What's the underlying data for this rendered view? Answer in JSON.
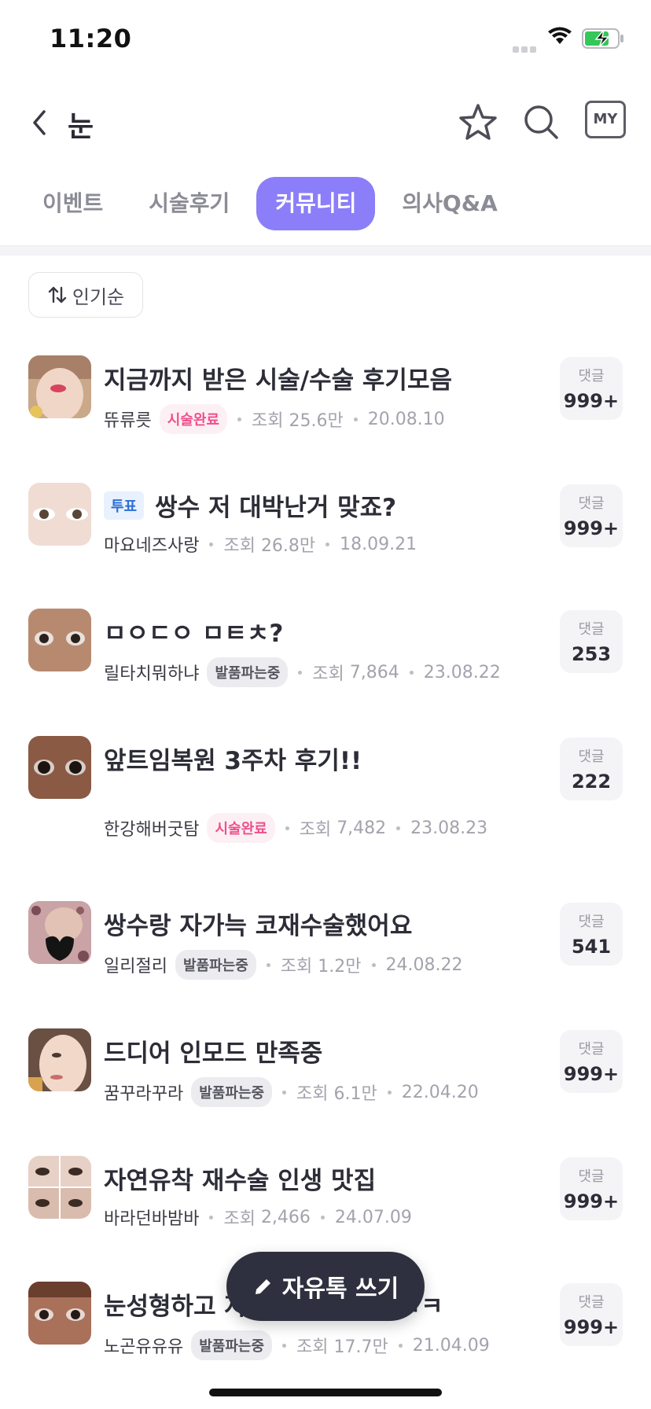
{
  "status_bar": {
    "time": "11:20"
  },
  "header": {
    "back_label": "<",
    "title": "눈",
    "my_label": "MY"
  },
  "tabs": [
    {
      "label": "이벤트",
      "active": false
    },
    {
      "label": "시술후기",
      "active": false
    },
    {
      "label": "커뮤니티",
      "active": true
    },
    {
      "label": "의사Q&A",
      "active": false
    }
  ],
  "sort": {
    "label": "인기순"
  },
  "comment_label": "댓글",
  "views_label": "조회",
  "posts": [
    {
      "title": "지금까지 받은 시술/수술 후기모음",
      "vote_tag": "",
      "author": "뜌류릇",
      "badge": "시술완료",
      "badge_type": "done",
      "views": "25.6만",
      "date": "20.08.10",
      "comments": "999+"
    },
    {
      "title": "쌍수 저 대박난거 맞죠?",
      "vote_tag": "투표",
      "author": "마요네즈사랑",
      "badge": "",
      "badge_type": "",
      "views": "26.8만",
      "date": "18.09.21",
      "comments": "999+"
    },
    {
      "title": "ㅁㅇㄷㅇ ㅁㅌㅊ?",
      "vote_tag": "",
      "author": "릴타치뭐하냐",
      "badge": "발품파는중",
      "badge_type": "sel",
      "views": "7,864",
      "date": "23.08.22",
      "comments": "253"
    },
    {
      "title": "앞트임복원 3주차 후기!!",
      "vote_tag": "",
      "author": "한강해버굿탐",
      "badge": "시술완료",
      "badge_type": "done",
      "views": "7,482",
      "date": "23.08.23",
      "comments": "222"
    },
    {
      "title": "쌍수랑 자가늑 코재수술했어요",
      "vote_tag": "",
      "author": "일리절리",
      "badge": "발품파는중",
      "badge_type": "sel",
      "views": "1.2만",
      "date": "24.08.22",
      "comments": "541"
    },
    {
      "title": "드디어 인모드 만족중",
      "vote_tag": "",
      "author": "꿈꾸라꾸라",
      "badge": "발품파는중",
      "badge_type": "sel",
      "views": "6.1만",
      "date": "22.04.20",
      "comments": "999+"
    },
    {
      "title": "자연유착 재수술 인생 맛집",
      "vote_tag": "",
      "author": "바라던바밤바",
      "badge": "",
      "badge_type": "",
      "views": "2,466",
      "date": "24.07.09",
      "comments": "999+"
    },
    {
      "title": "눈성형하고 자신감 생겼어요 ㅋㅋ",
      "vote_tag": "",
      "author": "노곤유유유",
      "badge": "발품파는중",
      "badge_type": "sel",
      "views": "17.7만",
      "date": "21.04.09",
      "comments": "999+"
    }
  ],
  "fab": {
    "label": "자유톡 쓰기"
  },
  "colors": {
    "accent": "#8b7ef8",
    "done": "#ee4f8a",
    "vote": "#2b6ed6",
    "fab_bg": "#2f303f"
  }
}
